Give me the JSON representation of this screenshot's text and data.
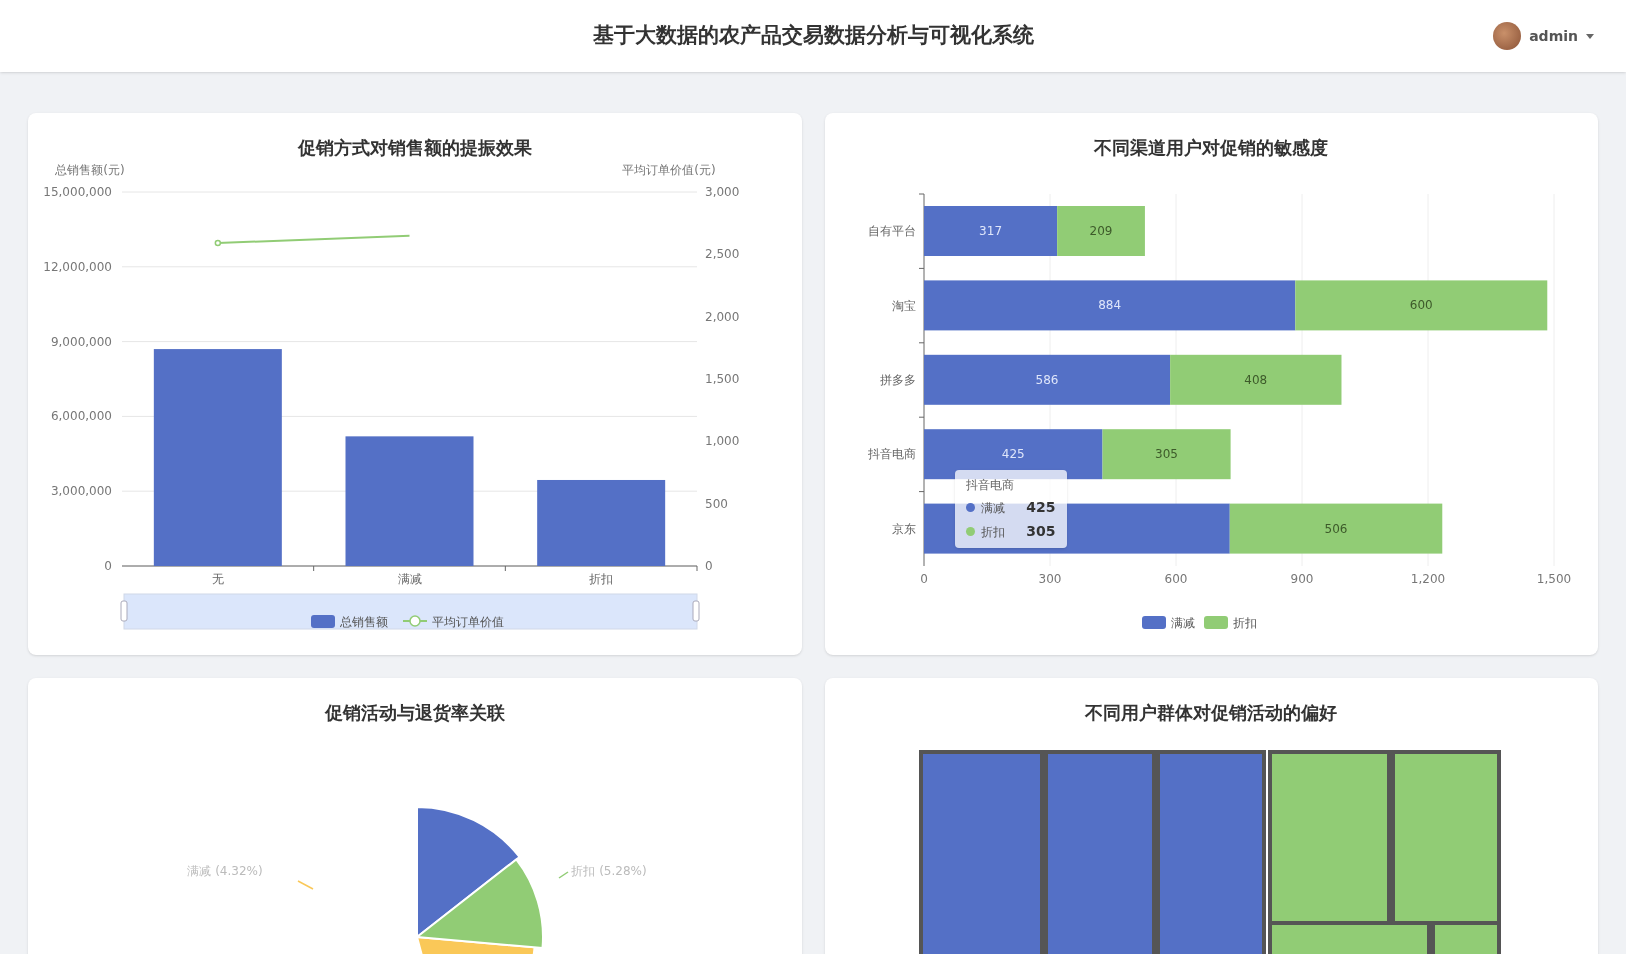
{
  "header": {
    "title": "基于大数据的农产品交易数据分析与可视化系统",
    "user": "admin"
  },
  "promotion_sales": {
    "title": "促销方式对销售额的提振效果",
    "chart_data": {
      "type": "bar",
      "categories": [
        "无",
        "满减",
        "折扣"
      ],
      "ylabel": "总销售额(元)",
      "ylim": [
        0,
        15000000
      ],
      "grid": true,
      "legend": "bottom",
      "yticks": [
        {
          "value": 0,
          "label": "0"
        },
        {
          "value": 3000000,
          "label": "3,000,000"
        },
        {
          "value": 6000000,
          "label": "6,000,000"
        },
        {
          "value": 9000000,
          "label": "9,000,000"
        },
        {
          "value": 12000000,
          "label": "12,000,000"
        },
        {
          "value": 15000000,
          "label": "15,000,000"
        }
      ],
      "series": [
        {
          "name": "总销售额",
          "color": "#5470c6",
          "values": [
            8700000,
            5200000,
            3450000
          ]
        }
      ]
    },
    "avg_order": {
      "chart_data": {
        "type": "line",
        "ylabel": "平均订单价值(元)",
        "ylim": [
          0,
          3000
        ],
        "legend": "bottom",
        "yticks": [
          {
            "value": 0,
            "label": "0"
          },
          {
            "value": 500,
            "label": "500"
          },
          {
            "value": 1000,
            "label": "1,000"
          },
          {
            "value": 1500,
            "label": "1,500"
          },
          {
            "value": 2000,
            "label": "2,000"
          },
          {
            "value": 2500,
            "label": "2,500"
          },
          {
            "value": 3000,
            "label": "3,000"
          }
        ],
        "series": [
          {
            "name": "平均订单价值",
            "color": "#91cc75",
            "values": [
              2590,
              2650,
              null
            ]
          }
        ]
      }
    }
  },
  "channel_sensitivity": {
    "title": "不同渠道用户对促销的敏感度",
    "chart_data": {
      "type": "bar",
      "orientation": "horizontal",
      "stacked": true,
      "grid": true,
      "legend": "bottom",
      "xlim": [
        0,
        1500
      ],
      "categories": [
        "自有平台",
        "淘宝",
        "拼多多",
        "抖音电商",
        "京东"
      ],
      "xticks": [
        {
          "value": 0,
          "label": "0"
        },
        {
          "value": 300,
          "label": "300"
        },
        {
          "value": 600,
          "label": "600"
        },
        {
          "value": 900,
          "label": "900"
        },
        {
          "value": 1200,
          "label": "1,200"
        },
        {
          "value": 1500,
          "label": "1,500"
        }
      ],
      "series": [
        {
          "name": "满减",
          "color": "#5470c6",
          "values": [
            317,
            884,
            586,
            425,
            728
          ],
          "value_labels": [
            "317",
            "884",
            "586",
            "425",
            null
          ]
        },
        {
          "name": "折扣",
          "color": "#91cc75",
          "values": [
            209,
            600,
            408,
            305,
            506
          ],
          "value_labels": [
            "209",
            "600",
            "408",
            "305",
            "506"
          ]
        }
      ]
    },
    "tooltip": {
      "title": "抖音电商",
      "items": [
        {
          "name": "满减",
          "value": "425",
          "color": "#5470c6"
        },
        {
          "name": "折扣",
          "value": "305",
          "color": "#91cc75"
        }
      ]
    }
  },
  "return_rate": {
    "title": "促销活动与退货率关联",
    "slices": [
      {
        "color": "#fac858",
        "label": "满减 (4.32%)"
      },
      {
        "color": "#5470c6"
      },
      {
        "color": "#91cc75",
        "label": "折扣 (5.28%)"
      }
    ]
  },
  "group_preference": {
    "title": "不同用户群体对促销活动的偏好",
    "groups": [
      {
        "color": "#5470c6"
      },
      {
        "color": "#91cc75"
      }
    ]
  }
}
